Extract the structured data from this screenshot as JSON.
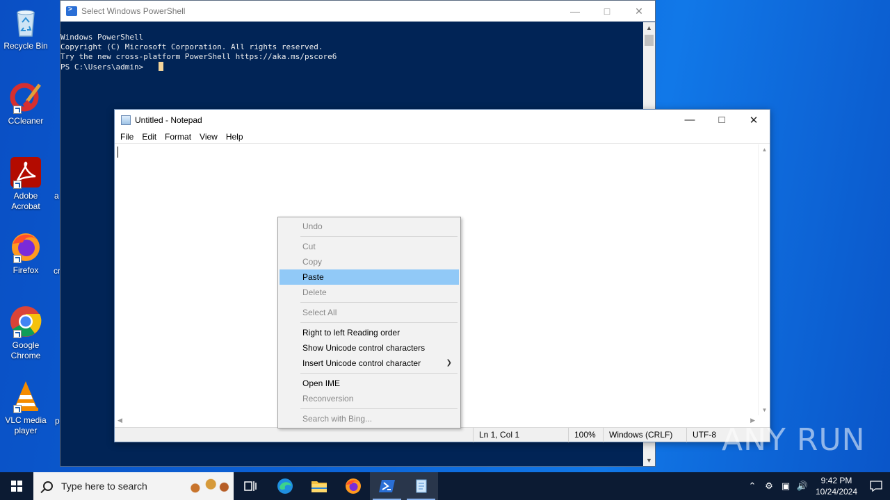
{
  "desktop": {
    "icons": [
      {
        "label": "Recycle Bin"
      },
      {
        "label": "CCleaner"
      },
      {
        "label": "Adobe Acrobat"
      },
      {
        "label": "Firefox"
      },
      {
        "label": "Google Chrome"
      },
      {
        "label": "VLC media player"
      }
    ],
    "cut_labels": [
      "a",
      "cr",
      "p"
    ]
  },
  "powershell": {
    "title": "Select Windows PowerShell",
    "lines": [
      "Windows PowerShell",
      "Copyright (C) Microsoft Corporation. All rights reserved.",
      "",
      "Try the new cross-platform PowerShell https://aka.ms/pscore6",
      ""
    ],
    "prompt": "PS C:\\Users\\admin>"
  },
  "notepad": {
    "title": "Untitled - Notepad",
    "menu": [
      "File",
      "Edit",
      "Format",
      "View",
      "Help"
    ],
    "status": {
      "position": "Ln 1, Col 1",
      "zoom": "100%",
      "line_ending": "Windows (CRLF)",
      "encoding": "UTF-8"
    }
  },
  "context_menu": {
    "items": {
      "undo": "Undo",
      "cut": "Cut",
      "copy": "Copy",
      "paste": "Paste",
      "delete": "Delete",
      "select_all": "Select All",
      "rtl": "Right to left Reading order",
      "show_unicode": "Show Unicode control characters",
      "insert_unicode": "Insert Unicode control character",
      "open_ime": "Open IME",
      "reconversion": "Reconversion",
      "search_bing": "Search with Bing..."
    }
  },
  "watermark": "ANY RUN",
  "taskbar": {
    "search_placeholder": "Type here to search",
    "time": "9:42 PM",
    "date": "10/24/2024"
  },
  "colors": {
    "ps_background": "#012456",
    "menu_highlight": "#91c9f7",
    "taskbar": "#0c1b33"
  }
}
